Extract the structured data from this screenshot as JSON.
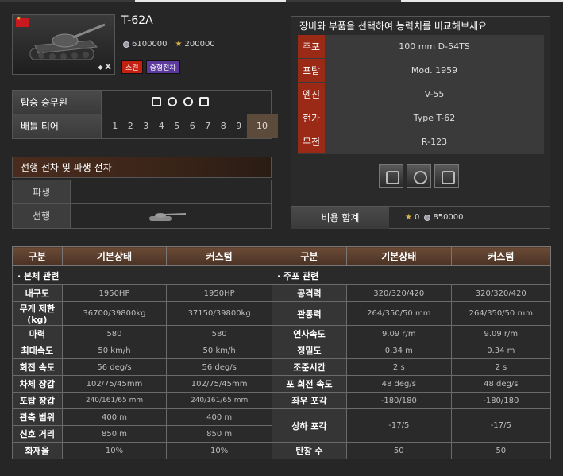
{
  "tank": {
    "name": "T-62A",
    "silver_price": "6100000",
    "gold_price": "200000",
    "tier_badge": "X",
    "nation_tag": "소련",
    "class_tag": "중형전차"
  },
  "info": {
    "crew_label": "탑승 승무원",
    "tier_label": "배틀 티어",
    "tiers": [
      "1",
      "2",
      "3",
      "4",
      "5",
      "6",
      "7",
      "8",
      "9",
      "10"
    ],
    "active_tier": "10"
  },
  "lineage": {
    "title": "선행 전차 및 파생 전차",
    "next_label": "파생",
    "prev_label": "선행"
  },
  "equipment": {
    "title": "장비와 부품을 선택하여 능력치를 비교해보세요",
    "rows": [
      {
        "key": "주포",
        "value": "100 mm D-54TS"
      },
      {
        "key": "포탑",
        "value": "Mod. 1959"
      },
      {
        "key": "엔진",
        "value": "V-55"
      },
      {
        "key": "현가",
        "value": "Type T-62"
      },
      {
        "key": "무전",
        "value": "R-123"
      }
    ],
    "total_label": "비용 합계",
    "total_gold": "0",
    "total_silver": "850000"
  },
  "stats": {
    "headers": [
      "구분",
      "기본상태",
      "커스텀",
      "구분",
      "기본상태",
      "커스텀"
    ],
    "left_section": "본체 관련",
    "right_section": "주포 관련",
    "left_rows": [
      {
        "label": "내구도",
        "base": "1950HP",
        "custom": "1950HP"
      },
      {
        "label": "무게 제한(kg)",
        "base": "36700/39800kg",
        "custom": "37150/39800kg"
      },
      {
        "label": "마력",
        "base": "580",
        "custom": "580"
      },
      {
        "label": "최대속도",
        "base": "50 km/h",
        "custom": "50 km/h"
      },
      {
        "label": "회전 속도",
        "base": "56 deg/s",
        "custom": "56 deg/s"
      },
      {
        "label": "차체 장갑",
        "base": "102/75/45mm",
        "custom": "102/75/45mm"
      },
      {
        "label": "포탑 장갑",
        "base": "240/161/65 mm",
        "custom": "240/161/65 mm"
      },
      {
        "label": "관측 범위",
        "base": "400 m",
        "custom": "400 m"
      },
      {
        "label": "신호 거리",
        "base": "850 m",
        "custom": "850 m"
      },
      {
        "label": "화재율",
        "base": "10%",
        "custom": "10%"
      }
    ],
    "right_rows": [
      {
        "label": "공격력",
        "base": "320/320/420",
        "custom": "320/320/420"
      },
      {
        "label": "관통력",
        "base": "264/350/50 mm",
        "custom": "264/350/50 mm"
      },
      {
        "label": "연사속도",
        "base": "9.09 r/m",
        "custom": "9.09 r/m"
      },
      {
        "label": "정밀도",
        "base": "0.34 m",
        "custom": "0.34 m"
      },
      {
        "label": "조준시간",
        "base": "2 s",
        "custom": "2 s"
      },
      {
        "label": "포 회전 속도",
        "base": "48 deg/s",
        "custom": "48 deg/s"
      },
      {
        "label": "좌우 포각",
        "base": "-180/180",
        "custom": "-180/180"
      },
      {
        "label": "상하 포각",
        "base": "-17/5",
        "custom": "-17/5"
      },
      {
        "label": "탄창 수",
        "base": "50",
        "custom": "50"
      }
    ]
  }
}
